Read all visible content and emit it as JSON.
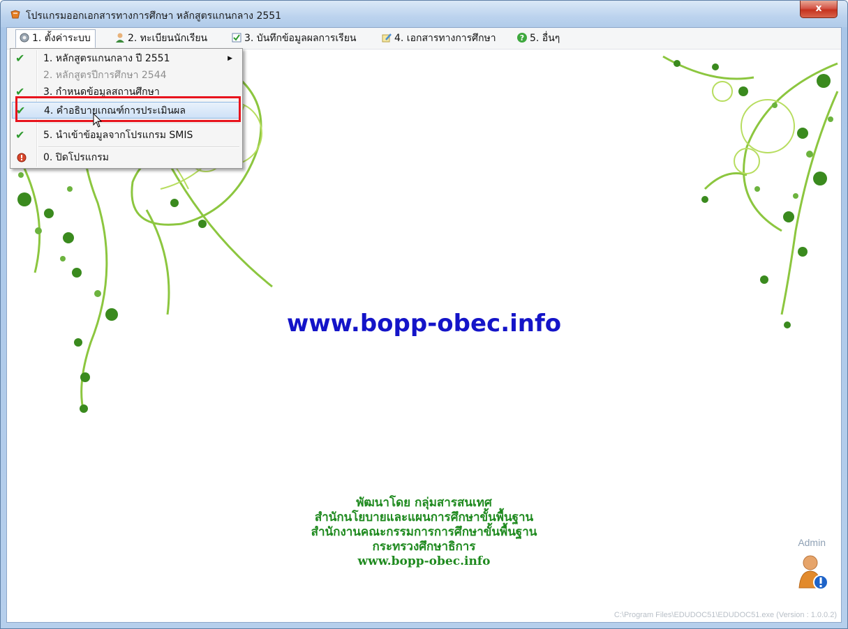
{
  "window": {
    "title": "โปรแกรมออกเอกสารทางการศึกษา หลักสูตรแกนกลาง 2551",
    "close_label": "x"
  },
  "menubar": {
    "items": [
      {
        "label": "1. ตั้งค่าระบบ",
        "icon": "gear-icon"
      },
      {
        "label": "2. ทะเบียนนักเรียน",
        "icon": "student-icon"
      },
      {
        "label": "3. บันทึกข้อมูลผลการเรียน",
        "icon": "checkbox-icon"
      },
      {
        "label": "4. เอกสารทางการศึกษา",
        "icon": "document-pen-icon"
      },
      {
        "label": "5. อื่นๆ",
        "icon": "help-icon"
      }
    ]
  },
  "dropdown": {
    "items": [
      {
        "label": "1. หลักสูตรแกนกลาง ปี 2551",
        "checked": true,
        "submenu": true
      },
      {
        "label": "2. หลักสูตรปีการศึกษา 2544",
        "checked": false,
        "disabled": true
      },
      {
        "label": "3. กำหนดข้อมูลสถานศึกษา",
        "checked": true
      },
      {
        "label": "4. คำอธิบายเกณฑ์การประเมินผล",
        "checked": true,
        "highlighted": true
      },
      {
        "label": "5. นำเข้าข้อมูลจากโปรแกรม SMIS",
        "checked": true
      },
      {
        "label": "0. ปิดโปรแกรม",
        "icon": "exit-icon"
      }
    ]
  },
  "main": {
    "website": "www.bopp-obec.info",
    "credits": [
      "พัฒนาโดย กลุ่มสารสนเทศ",
      "สำนักนโยบายและแผนการศึกษาขั้นพื้นฐาน",
      "สำนักงานคณะกรรมการการศึกษาขั้นพื้นฐาน",
      "กระทรวงศึกษาธิการ",
      "www.bopp-obec.info"
    ],
    "user_label": "Admin",
    "user_icon": "user-warning-icon",
    "exe_path": "C:\\Program Files\\EDUDOC51\\EDUDOC51.exe (Version : 1.0.0.2)"
  },
  "colors": {
    "website": "#1414c8",
    "credits": "#1f8a1f",
    "highlight_box": "#e8141d",
    "check": "#2f9a2f"
  }
}
